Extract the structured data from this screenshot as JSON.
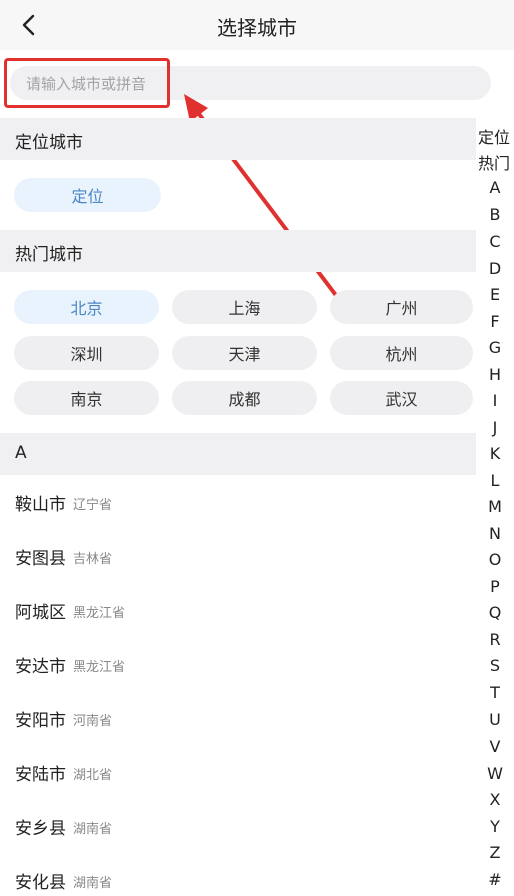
{
  "header": {
    "title": "选择城市",
    "back_icon": "chevron-left-icon"
  },
  "search": {
    "placeholder": "请输入城市或拼音",
    "value": ""
  },
  "annotation": {
    "color": "#e0312f"
  },
  "sections": {
    "located": "定位城市",
    "hot": "热门城市",
    "letter_a": "A"
  },
  "locate_button": "定位",
  "hot_cities": [
    "北京",
    "上海",
    "广州",
    "深圳",
    "天津",
    "杭州",
    "南京",
    "成都",
    "武汉"
  ],
  "city_list": [
    {
      "name": "鞍山市",
      "province": "辽宁省"
    },
    {
      "name": "安图县",
      "province": "吉林省"
    },
    {
      "name": "阿城区",
      "province": "黑龙江省"
    },
    {
      "name": "安达市",
      "province": "黑龙江省"
    },
    {
      "name": "安阳市",
      "province": "河南省"
    },
    {
      "name": "安陆市",
      "province": "湖北省"
    },
    {
      "name": "安乡县",
      "province": "湖南省"
    },
    {
      "name": "安化县",
      "province": "湖南省"
    }
  ],
  "index": [
    "定位",
    "热门",
    "A",
    "B",
    "C",
    "D",
    "E",
    "F",
    "G",
    "H",
    "I",
    "J",
    "K",
    "L",
    "M",
    "N",
    "O",
    "P",
    "Q",
    "R",
    "S",
    "T",
    "U",
    "V",
    "W",
    "X",
    "Y",
    "Z",
    "#"
  ]
}
